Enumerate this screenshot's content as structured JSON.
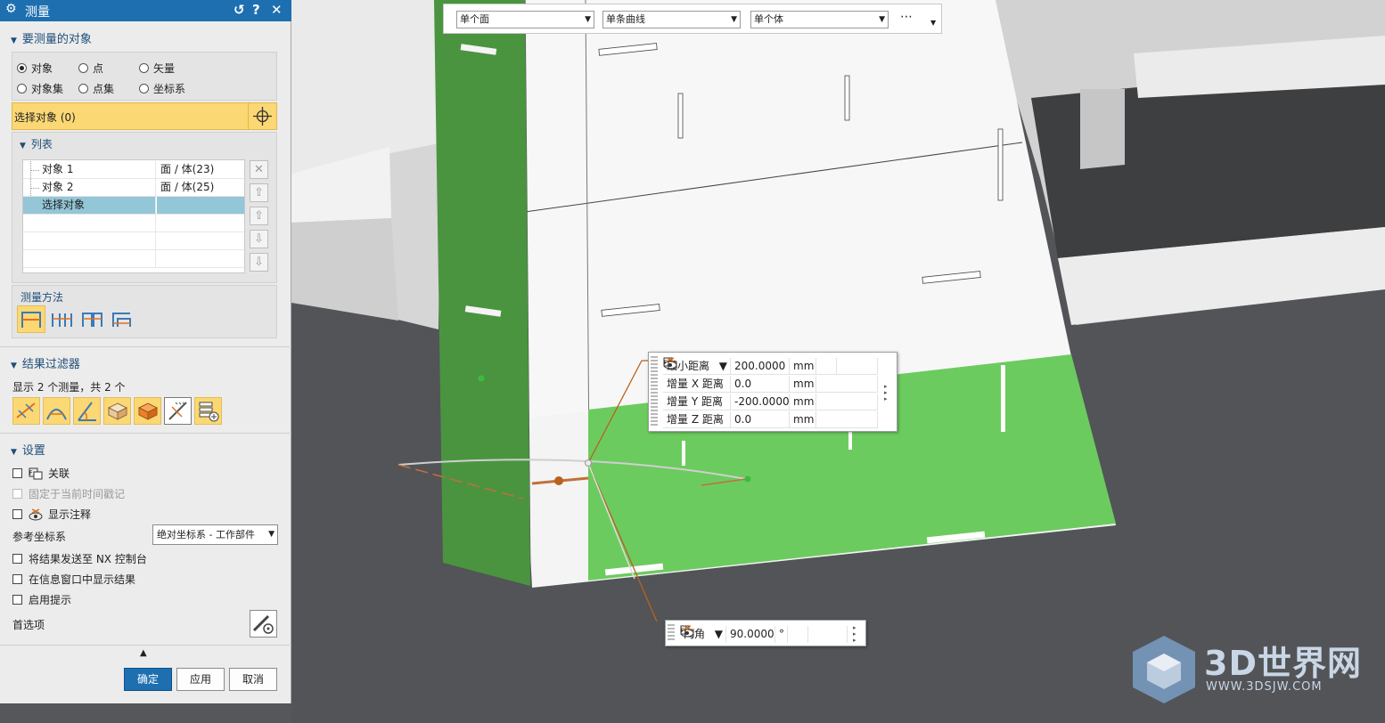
{
  "dialog": {
    "title": "测量",
    "section_objects": {
      "title": "要测量的对象",
      "radios": [
        {
          "label": "对象",
          "selected": true
        },
        {
          "label": "点",
          "selected": false
        },
        {
          "label": "矢量",
          "selected": false
        },
        {
          "label": "对象集",
          "selected": false
        },
        {
          "label": "点集",
          "selected": false
        },
        {
          "label": "坐标系",
          "selected": false
        }
      ],
      "select_label": "选择对象 (0)",
      "list_title": "列表",
      "list_rows": [
        {
          "name": "对象 1",
          "type": "面 / 体(23)"
        },
        {
          "name": "对象 2",
          "type": "面 / 体(25)"
        },
        {
          "name": "选择对象",
          "type": ""
        }
      ],
      "method_title": "测量方法"
    },
    "section_filter": {
      "title": "结果过滤器",
      "summary": "显示 2 个测量，共 2 个"
    },
    "section_settings": {
      "title": "设置",
      "associative": "关联",
      "freeze_label": "固定于当前时间戳记",
      "show_annotation": "显示注释",
      "ref_csys_label": "参考坐标系",
      "ref_csys_value": "绝对坐标系 - 工作部件",
      "send_nx": "将结果发送至 NX 控制台",
      "show_info": "在信息窗口中显示结果",
      "enable_tips": "启用提示",
      "preferences": "首选项"
    },
    "buttons": {
      "ok": "确定",
      "apply": "应用",
      "cancel": "取消"
    }
  },
  "selection_bar": {
    "face_rule": "单个面",
    "curve_rule": "单条曲线",
    "body_rule": "单个体",
    "more": "⋯"
  },
  "measure_distance": {
    "rows": [
      {
        "label": "最小距离",
        "dropdown": true,
        "value": "200.0000",
        "unit": "mm"
      },
      {
        "label": "增量 X 距离",
        "value": "0.0",
        "unit": "mm"
      },
      {
        "label": "增量 Y 距离",
        "value": "-200.0000",
        "unit": "mm"
      },
      {
        "label": "增量 Z 距离",
        "value": "0.0",
        "unit": "mm"
      }
    ]
  },
  "measure_angle": {
    "label": "内角",
    "value": "90.0000",
    "unit": "°"
  },
  "watermark": {
    "brand": "3D世界网",
    "url": "WWW.3DSJW.COM"
  },
  "colors": {
    "title_bar": "#1d6fb0",
    "selection_highlight": "#fbd874",
    "face_green": "#6ccb5f",
    "face_dark_green": "#4a9440"
  }
}
